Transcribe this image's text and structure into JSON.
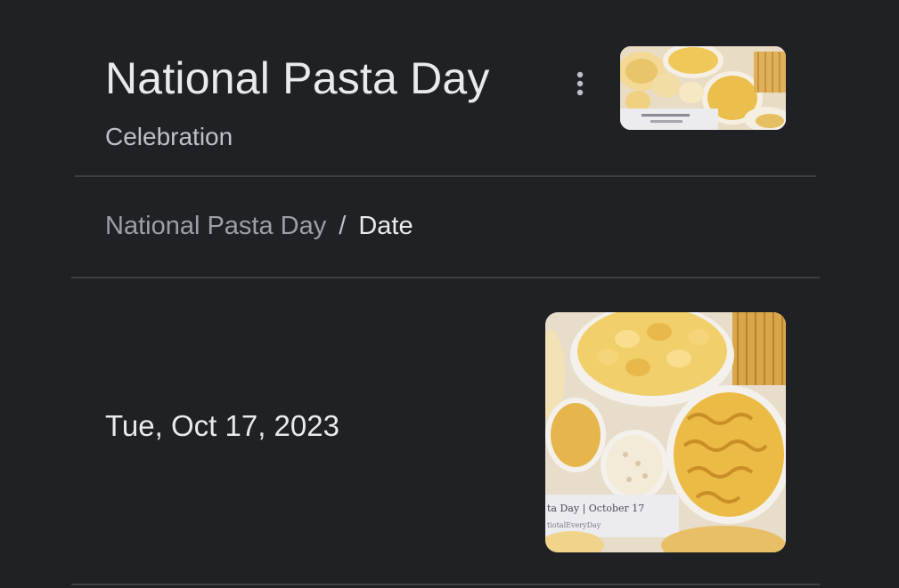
{
  "header": {
    "title": "National Pasta Day",
    "subtitle": "Celebration",
    "more_icon": "more-vert-icon"
  },
  "breadcrumb": {
    "parent": "National Pasta Day",
    "separator": "/",
    "current": "Date"
  },
  "detail": {
    "date": "Tue, Oct 17, 2023"
  },
  "images": {
    "header_thumbnail": "pasta-assortment-image",
    "main_image": "pasta-bowls-image",
    "main_image_caption_line1": "ta Day | October 17",
    "main_image_caption_line2": "tiotalEveryDay"
  },
  "colors": {
    "background": "#202124",
    "text_primary": "#e8eaed",
    "text_secondary": "#9aa0a6",
    "divider": "#3c4043"
  }
}
